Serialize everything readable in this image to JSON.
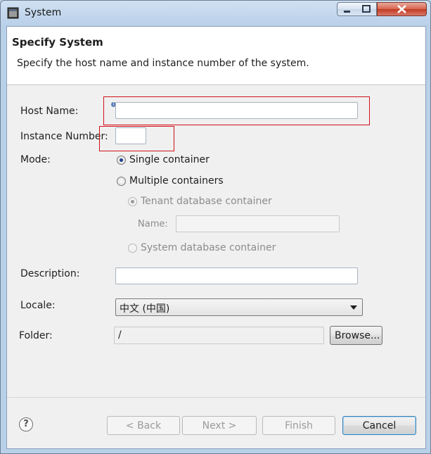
{
  "window": {
    "title": "System"
  },
  "title_controls": {
    "minimize": "−",
    "maximize": "□",
    "close": "✕"
  },
  "banner": {
    "title": "Specify System",
    "description": "Specify the host name and instance number of the system."
  },
  "form": {
    "host_name_label": "Host Name:",
    "host_name_value": "",
    "instance_number_label": "Instance Number:",
    "instance_number_value": "",
    "mode_label": "Mode:",
    "mode_single": "Single container",
    "mode_multiple": "Multiple containers",
    "tenant_db": "Tenant database container",
    "name_label": "Name:",
    "name_value": "",
    "system_db": "System database container",
    "description_label": "Description:",
    "description_value": "",
    "locale_label": "Locale:",
    "locale_value": "中文 (中国)",
    "folder_label": "Folder:",
    "folder_value": "/",
    "browse_label": "Browse..."
  },
  "buttons": {
    "help": "?",
    "back": "< Back",
    "next": "Next >",
    "finish": "Finish",
    "cancel": "Cancel"
  },
  "colors": {
    "highlight_border": "#d0111a",
    "default_button_border": "#3c7fb1"
  }
}
